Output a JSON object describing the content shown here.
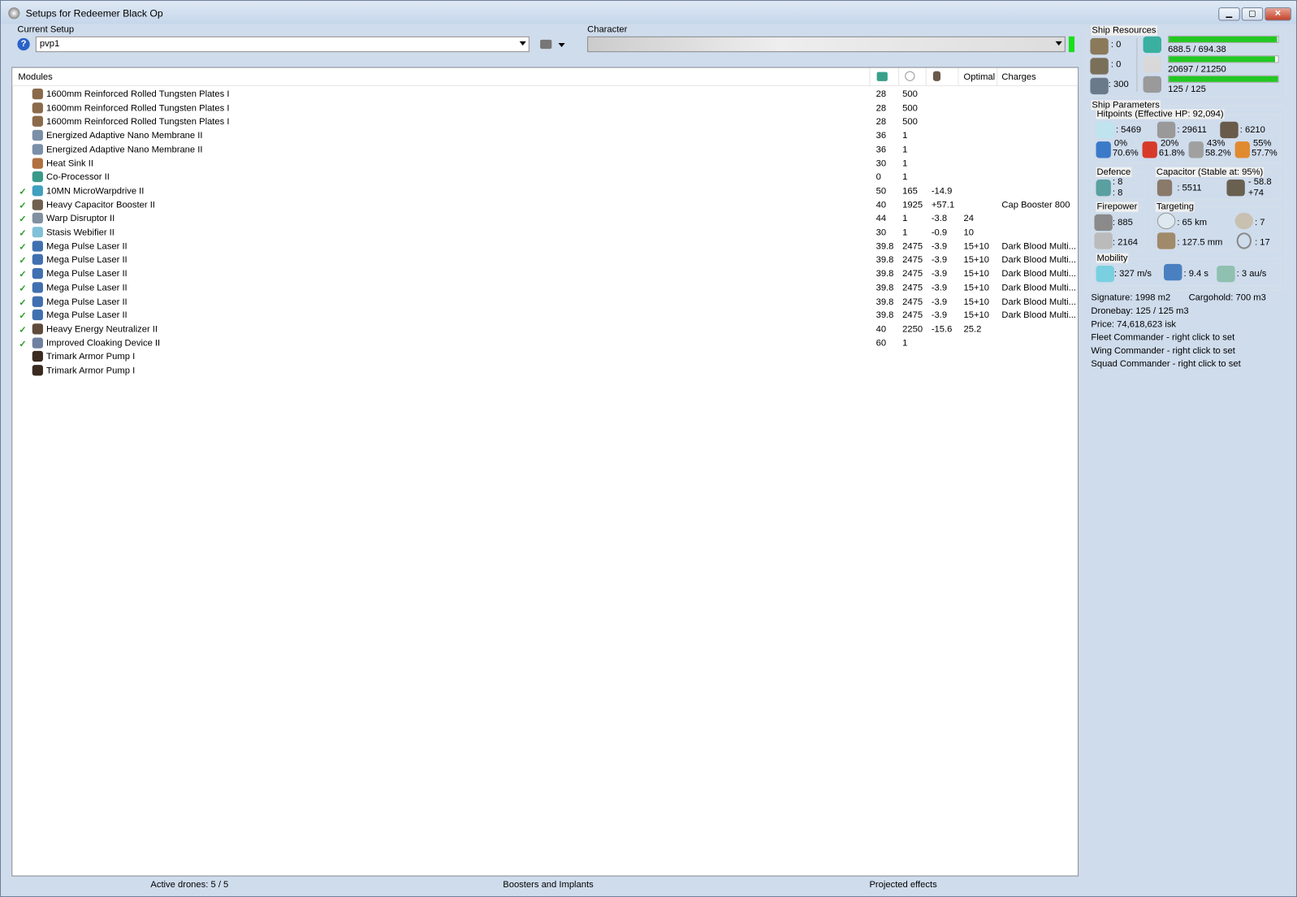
{
  "window": {
    "title": "Setups for Redeemer Black Op",
    "min": "▁",
    "max": "▢",
    "close": "✕"
  },
  "setup": {
    "label": "Current Setup",
    "value": "pvp1",
    "help": "?"
  },
  "character": {
    "label": "Character",
    "value": ""
  },
  "modules": {
    "headers": {
      "name": "Modules",
      "optimal": "Optimal",
      "charges": "Charges"
    },
    "rows": [
      {
        "active": false,
        "name": "1600mm Reinforced Rolled Tungsten Plates I",
        "cpu": "28",
        "pg": "500",
        "cap": "",
        "optimal": "",
        "charges": "",
        "color": "#8a6a4a"
      },
      {
        "active": false,
        "name": "1600mm Reinforced Rolled Tungsten Plates I",
        "cpu": "28",
        "pg": "500",
        "cap": "",
        "optimal": "",
        "charges": "",
        "color": "#8a6a4a"
      },
      {
        "active": false,
        "name": "1600mm Reinforced Rolled Tungsten Plates I",
        "cpu": "28",
        "pg": "500",
        "cap": "",
        "optimal": "",
        "charges": "",
        "color": "#8a6a4a"
      },
      {
        "active": false,
        "name": "Energized Adaptive Nano Membrane II",
        "cpu": "36",
        "pg": "1",
        "cap": "",
        "optimal": "",
        "charges": "",
        "color": "#7a8fa8"
      },
      {
        "active": false,
        "name": "Energized Adaptive Nano Membrane II",
        "cpu": "36",
        "pg": "1",
        "cap": "",
        "optimal": "",
        "charges": "",
        "color": "#7a8fa8"
      },
      {
        "active": false,
        "name": "Heat Sink II",
        "cpu": "30",
        "pg": "1",
        "cap": "",
        "optimal": "",
        "charges": "",
        "color": "#b07040"
      },
      {
        "active": false,
        "name": "Co-Processor II",
        "cpu": "0",
        "pg": "1",
        "cap": "",
        "optimal": "",
        "charges": "",
        "color": "#3a9a8a"
      },
      {
        "active": true,
        "name": "10MN MicroWarpdrive II",
        "cpu": "50",
        "pg": "165",
        "cap": "-14.9",
        "optimal": "",
        "charges": "",
        "color": "#40a0c0"
      },
      {
        "active": true,
        "name": "Heavy Capacitor Booster II",
        "cpu": "40",
        "pg": "1925",
        "cap": "+57.1",
        "optimal": "",
        "charges": "Cap Booster 800",
        "color": "#706050"
      },
      {
        "active": true,
        "name": "Warp Disruptor II",
        "cpu": "44",
        "pg": "1",
        "cap": "-3.8",
        "optimal": "24",
        "charges": "",
        "color": "#8090a0"
      },
      {
        "active": true,
        "name": "Stasis Webifier II",
        "cpu": "30",
        "pg": "1",
        "cap": "-0.9",
        "optimal": "10",
        "charges": "",
        "color": "#80c0d8"
      },
      {
        "active": true,
        "name": "Mega Pulse Laser II",
        "cpu": "39.8",
        "pg": "2475",
        "cap": "-3.9",
        "optimal": "15+10",
        "charges": "Dark Blood Multi...",
        "color": "#4070b0"
      },
      {
        "active": true,
        "name": "Mega Pulse Laser II",
        "cpu": "39.8",
        "pg": "2475",
        "cap": "-3.9",
        "optimal": "15+10",
        "charges": "Dark Blood Multi...",
        "color": "#4070b0"
      },
      {
        "active": true,
        "name": "Mega Pulse Laser II",
        "cpu": "39.8",
        "pg": "2475",
        "cap": "-3.9",
        "optimal": "15+10",
        "charges": "Dark Blood Multi...",
        "color": "#4070b0"
      },
      {
        "active": true,
        "name": "Mega Pulse Laser II",
        "cpu": "39.8",
        "pg": "2475",
        "cap": "-3.9",
        "optimal": "15+10",
        "charges": "Dark Blood Multi...",
        "color": "#4070b0"
      },
      {
        "active": true,
        "name": "Mega Pulse Laser II",
        "cpu": "39.8",
        "pg": "2475",
        "cap": "-3.9",
        "optimal": "15+10",
        "charges": "Dark Blood Multi...",
        "color": "#4070b0"
      },
      {
        "active": true,
        "name": "Mega Pulse Laser II",
        "cpu": "39.8",
        "pg": "2475",
        "cap": "-3.9",
        "optimal": "15+10",
        "charges": "Dark Blood Multi...",
        "color": "#4070b0"
      },
      {
        "active": true,
        "name": "Heavy Energy Neutralizer II",
        "cpu": "40",
        "pg": "2250",
        "cap": "-15.6",
        "optimal": "25.2",
        "charges": "",
        "color": "#604a3a"
      },
      {
        "active": true,
        "name": "Improved Cloaking Device II",
        "cpu": "60",
        "pg": "1",
        "cap": "",
        "optimal": "",
        "charges": "",
        "color": "#7080a0"
      },
      {
        "active": false,
        "name": "Trimark Armor Pump I",
        "cpu": "",
        "pg": "",
        "cap": "",
        "optimal": "",
        "charges": "",
        "color": "#3a2a20"
      },
      {
        "active": false,
        "name": "Trimark Armor Pump I",
        "cpu": "",
        "pg": "",
        "cap": "",
        "optimal": "",
        "charges": "",
        "color": "#3a2a20"
      }
    ]
  },
  "resources": {
    "label": "Ship Resources",
    "turrets": ": 0",
    "launchers": ": 0",
    "calibration": ": 300",
    "cpu": "688.5 / 694.38",
    "powergrid": "20697 / 21250",
    "drones": "125 / 125",
    "cpu_fraction": 0.992,
    "pg_fraction": 0.974,
    "drone_fraction": 1.0
  },
  "params": {
    "label": "Ship Parameters",
    "hp_label": "Hitpoints (Effective HP: 92,094)",
    "shield": ": 5469",
    "armor": ": 29611",
    "structure": ": 6210",
    "resists": [
      {
        "a": "0%",
        "b": "70.6%",
        "color": "#3a7ac8"
      },
      {
        "a": "20%",
        "b": "61.8%",
        "color": "#d83a2a"
      },
      {
        "a": "43%",
        "b": "58.2%",
        "color": "#a0a0a0"
      },
      {
        "a": "55%",
        "b": "57.7%",
        "color": "#e08a30"
      }
    ],
    "defence_label": "Defence",
    "def1": ": 8",
    "def2": ": 8",
    "cap_label": "Capacitor (Stable at: 95%)",
    "cap_amount": ": 5511",
    "cap_use": "- 58.8",
    "cap_gain": "+74",
    "fire_label": "Firepower",
    "dps": ": 885",
    "volley": ": 2164",
    "target_label": "Targeting",
    "range": ": 65 km",
    "targets": ": 7",
    "res": ": 127.5 mm",
    "sensor": ": 17",
    "mob_label": "Mobility",
    "speed": ": 327 m/s",
    "align": ": 9.4 s",
    "warp": ": 3 au/s"
  },
  "info": {
    "signature": "Signature: 1998 m2",
    "cargo": "Cargohold: 700 m3",
    "dronebay": "Dronebay: 125 / 125 m3",
    "price": "Price: 74,618,623 isk",
    "fleet": "Fleet Commander - right click to set",
    "wing": "Wing Commander - right click to set",
    "squad": "Squad Commander - right click to set"
  },
  "bottom": {
    "drones": "Active drones: 5 / 5",
    "boosters": "Boosters and Implants",
    "projected": "Projected effects"
  }
}
